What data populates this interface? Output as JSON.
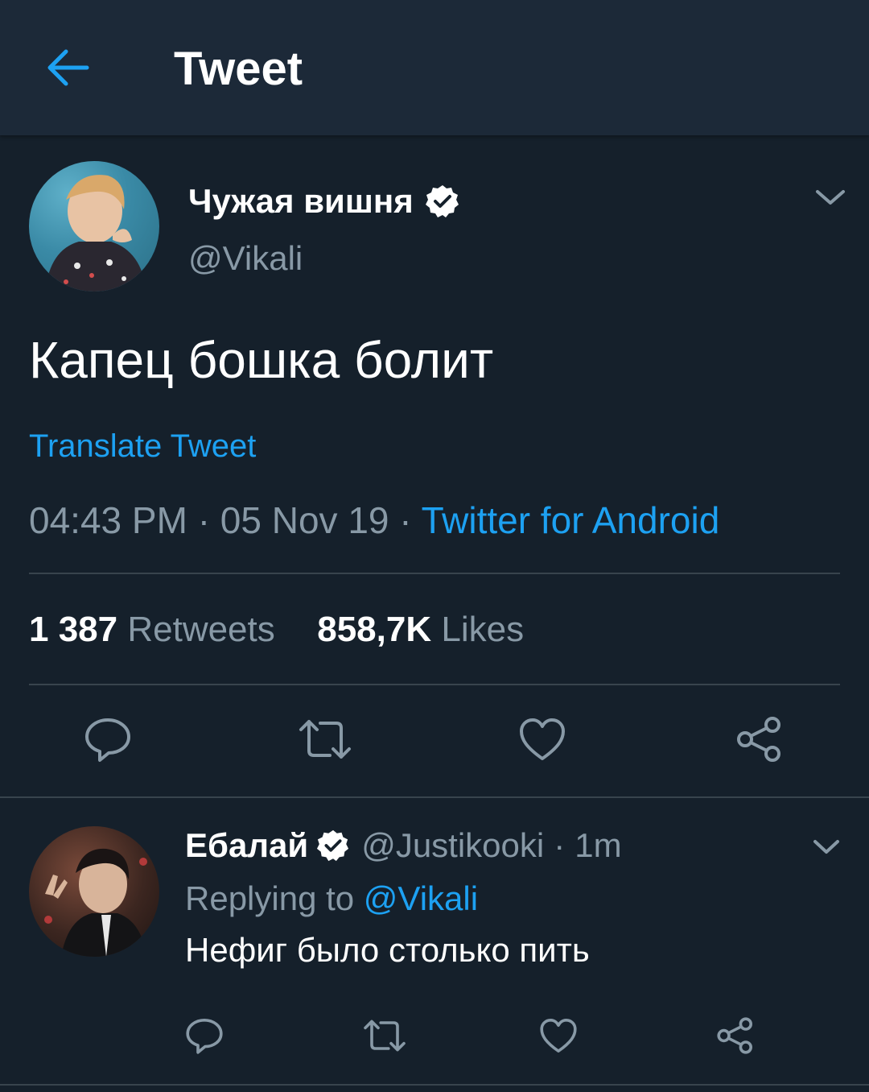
{
  "header": {
    "title": "Tweet"
  },
  "tweet": {
    "author_name": "Чужая вишня",
    "author_handle": "@Vikali",
    "text": "Капец бошка болит",
    "translate_label": "Translate Tweet",
    "time": "04:43 PM",
    "date": "05 Nov 19",
    "separator": "·",
    "source": "Twitter for Android",
    "retweets_count": "1 387",
    "retweets_label": "Retweets",
    "likes_count": "858,7K",
    "likes_label": "Likes"
  },
  "reply": {
    "author_name": "Ебалай",
    "author_handle": "@Justikooki",
    "age": "1m",
    "separator": "·",
    "replying_prefix": "Replying to",
    "replying_mention": "@Vikali",
    "text": "Нефиг было столько пить"
  },
  "colors": {
    "background": "#15202b",
    "header": "#1c2938",
    "accent": "#1da1f2",
    "secondary_text": "#8899a6",
    "divider": "#38444d"
  },
  "icons": {
    "back": "arrow-left-icon",
    "verified": "verified-badge-icon",
    "caret": "chevron-down-icon",
    "reply": "reply-bubble-icon",
    "retweet": "retweet-icon",
    "like": "heart-icon",
    "share": "share-icon"
  }
}
